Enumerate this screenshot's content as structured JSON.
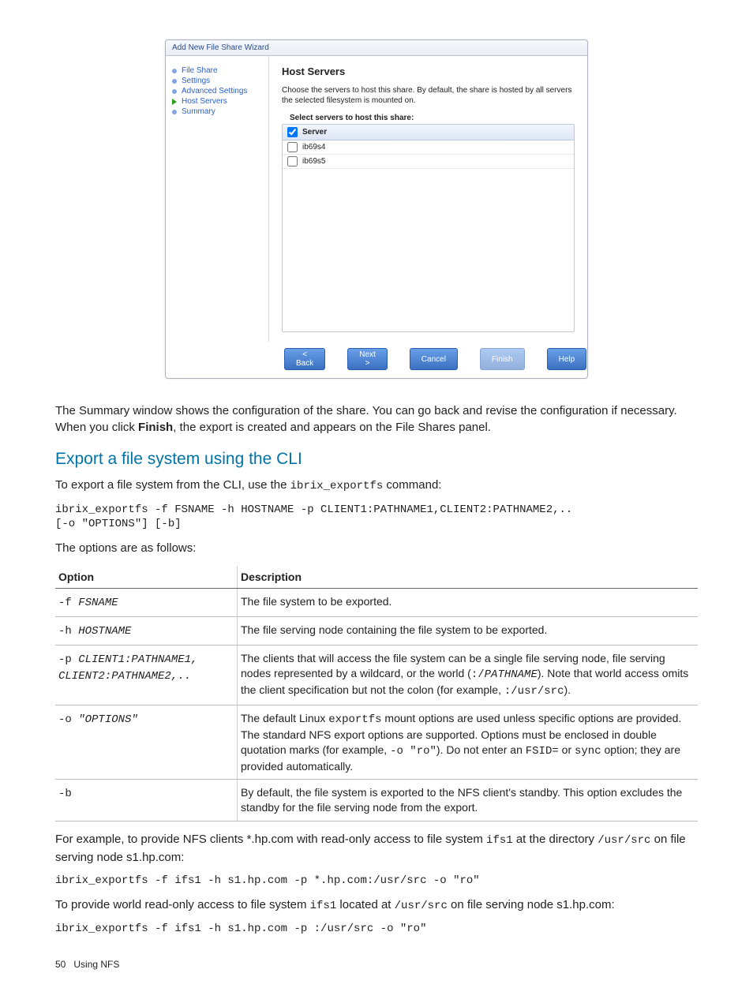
{
  "wizard": {
    "title": "Add New File Share Wizard",
    "nav": [
      "File Share",
      "Settings",
      "Advanced Settings",
      "Host Servers",
      "Summary"
    ],
    "currentIndex": 3,
    "heading": "Host Servers",
    "desc": "Choose the servers to host this share. By default, the share is hosted by all servers the selected filesystem is mounted on.",
    "subhead": "Select servers to host this share:",
    "columns": {
      "server": "Server"
    },
    "rows": [
      "ib69s4",
      "ib69s5"
    ],
    "buttons": {
      "back": "< Back",
      "next": "Next >",
      "cancel": "Cancel",
      "finish": "Finish",
      "help": "Help"
    }
  },
  "para1_pre": "The Summary window shows the configuration of the share. You can go back and revise the configuration if necessary. When you click ",
  "para1_bold": "Finish",
  "para1_post": ", the export is created and appears on the File Shares panel.",
  "h2": "Export a file system using the CLI",
  "cli_intro_pre": "To export a file system from the CLI, use the ",
  "cli_intro_code": "ibrix_exportfs",
  "cli_intro_post": " command:",
  "cli_block": "ibrix_exportfs -f FSNAME -h HOSTNAME -p CLIENT1:PATHNAME1,CLIENT2:PATHNAME2,..\n[-o \"OPTIONS\"] [-b]",
  "options_lead": "The options are as follows:",
  "table": {
    "head": [
      "Option",
      "Description"
    ],
    "rows": [
      {
        "opt_html": "-f <i>FSNAME</i>",
        "desc_html": "The file system to be exported."
      },
      {
        "opt_html": "-h <i>HOSTNAME</i>",
        "desc_html": "The file serving node containing the file system to be exported."
      },
      {
        "opt_html": "-p <i>CLIENT1:PATHNAME1,<br>CLIENT2:PATHNAME2,..</i>",
        "desc_html": "The clients that will access the file system can be a single file serving node, file serving nodes represented by a wildcard, or the world (<code>:/<i>PATHNAME</i></code>). Note that world access omits the client specification but not the colon (for example, <code>:/usr/src</code>)."
      },
      {
        "opt_html": "-o <i>\"OPTIONS\"</i>",
        "desc_html": "The default Linux <code>exportfs</code> mount options are used unless specific options are provided. The standard NFS export options are supported. Options must be enclosed in double quotation marks (for example, <code>-o \"ro\"</code>). Do not enter an <code>FSID=</code> or <code>sync</code> option; they are provided automatically."
      },
      {
        "opt_html": "-b",
        "desc_html": "By default, the file system is exported to the NFS client's standby. This option excludes the standby for the file serving node from the export."
      }
    ]
  },
  "ex1_pre": "For example, to provide NFS clients *.hp.com with read-only access to file system ",
  "ex1_code1": "ifs1",
  "ex1_mid": " at the directory ",
  "ex1_code2": "/usr/src",
  "ex1_post": " on file serving node s1.hp.com:",
  "ex1_cmd": "ibrix_exportfs -f ifs1 -h s1.hp.com -p *.hp.com:/usr/src -o \"ro\"",
  "ex2_pre": "To provide world read-only access to file system ",
  "ex2_code1": "ifs1",
  "ex2_mid": " located at ",
  "ex2_code2": "/usr/src",
  "ex2_post": " on file serving node s1.hp.com:",
  "ex2_cmd": "ibrix_exportfs -f ifs1 -h s1.hp.com -p :/usr/src -o \"ro\"",
  "footer": {
    "page": "50",
    "section": "Using NFS"
  }
}
